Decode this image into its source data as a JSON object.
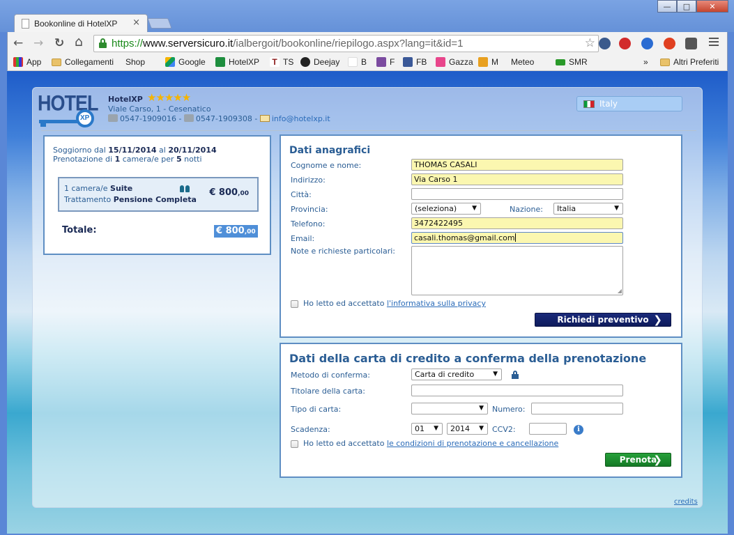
{
  "browser": {
    "tab_title": "Bookonline di HotelXP",
    "tab_close": "×",
    "url_https": "https://",
    "url_host": "www.serversicuro.it",
    "url_path": "/ialbergoit/bookonline/riepilogo.aspx?lang=it&id=1",
    "back": "←",
    "forward": "→",
    "reload": "↻",
    "home": "⌂",
    "star": "☆",
    "win_min": "—",
    "win_max": "□",
    "win_close": "✕"
  },
  "bookmarks": [
    {
      "label": "App",
      "icon": "apps-icon"
    },
    {
      "label": "Collegamenti",
      "icon": "folder-icon"
    },
    {
      "label": "Shop",
      "icon": "page-icon"
    },
    {
      "label": "Google",
      "icon": "drive-icon"
    },
    {
      "label": "HotelXP",
      "icon": "sheet-icon"
    },
    {
      "label": "TS",
      "icon": "ts-icon"
    },
    {
      "label": "Deejay",
      "icon": "deejay-icon"
    },
    {
      "label": "B",
      "icon": "blank-icon"
    },
    {
      "label": "F",
      "icon": "tumblr-icon"
    },
    {
      "label": "FB",
      "icon": "facebook-icon"
    },
    {
      "label": "Gazza",
      "icon": "gazza-icon"
    },
    {
      "label": "M",
      "icon": "m-icon"
    },
    {
      "label": "Meteo",
      "icon": "page-icon"
    },
    {
      "label": "SMR",
      "icon": "smr-icon"
    },
    {
      "label": "»",
      "icon": "more-icon"
    },
    {
      "label": "Altri Preferiti",
      "icon": "folder-icon"
    }
  ],
  "hotel": {
    "logo_text": "HOTEL",
    "logo_xp": "XP",
    "name": "HotelXP",
    "stars": "★★★★★",
    "address": "Viale Carso, 1 - Cesenatico",
    "phone": "0547-1909016",
    "sep1": " - ",
    "fax": "0547-1909308",
    "sep2": " - ",
    "email": "info@hotelxp.it",
    "language": "Italy"
  },
  "summary": {
    "soggiorno_dal": "Soggiorno dal",
    "date_from": "15/11/2014",
    "al": "al",
    "date_to": "20/11/2014",
    "prenotazione_di": "Prenotazione di",
    "rooms_count": "1",
    "camere_per": "camera/e per",
    "nights": "5",
    "notti": "notti",
    "room_prefix": "1 camera/e",
    "room_type": "Suite",
    "treatment_prefix": "Trattamento",
    "treatment": "Pensione Completa",
    "room_price": "€ 800",
    "room_price_cents": ",00",
    "total_label": "Totale:",
    "total_value": "€ 800",
    "total_cents": ",00"
  },
  "anagrafici": {
    "title": "Dati anagrafici",
    "cognome_label": "Cognome e nome:",
    "cognome_value": "THOMAS CASALI",
    "indirizzo_label": "Indirizzo:",
    "indirizzo_value": "Via Carso 1",
    "citta_label": "Città:",
    "citta_value": "",
    "provincia_label": "Provincia:",
    "provincia_value": "(seleziona)",
    "nazione_label": "Nazione:",
    "nazione_value": "Italia",
    "telefono_label": "Telefono:",
    "telefono_value": "3472422495",
    "email_label": "Email:",
    "email_value": "casali.thomas@gmail.com",
    "note_label": "Note e richieste particolari:",
    "privacy_text": "Ho letto ed accettato",
    "privacy_link": "l'informativa sulla privacy",
    "submit": "Richiedi preventivo"
  },
  "carta": {
    "title": "Dati della carta di credito a conferma della prenotazione",
    "metodo_label": "Metodo di conferma:",
    "metodo_value": "Carta di credito",
    "titolare_label": "Titolare della carta:",
    "tipo_label": "Tipo di carta:",
    "tipo_value": "",
    "numero_label": "Numero:",
    "scadenza_label": "Scadenza:",
    "mese_value": "01",
    "anno_value": "2014",
    "ccv_label": "CCV2:",
    "info": "i",
    "condizioni_text": "Ho letto ed accettato",
    "condizioni_link": "le condizioni di prenotazione e cancellazione",
    "submit": "Prenota"
  },
  "footer": {
    "credits": "credits"
  },
  "colors": {
    "accent": "#2a5d94",
    "filled_field": "#fbf7b0",
    "prenota": "#1f8f30",
    "preventivo": "#13206a"
  }
}
